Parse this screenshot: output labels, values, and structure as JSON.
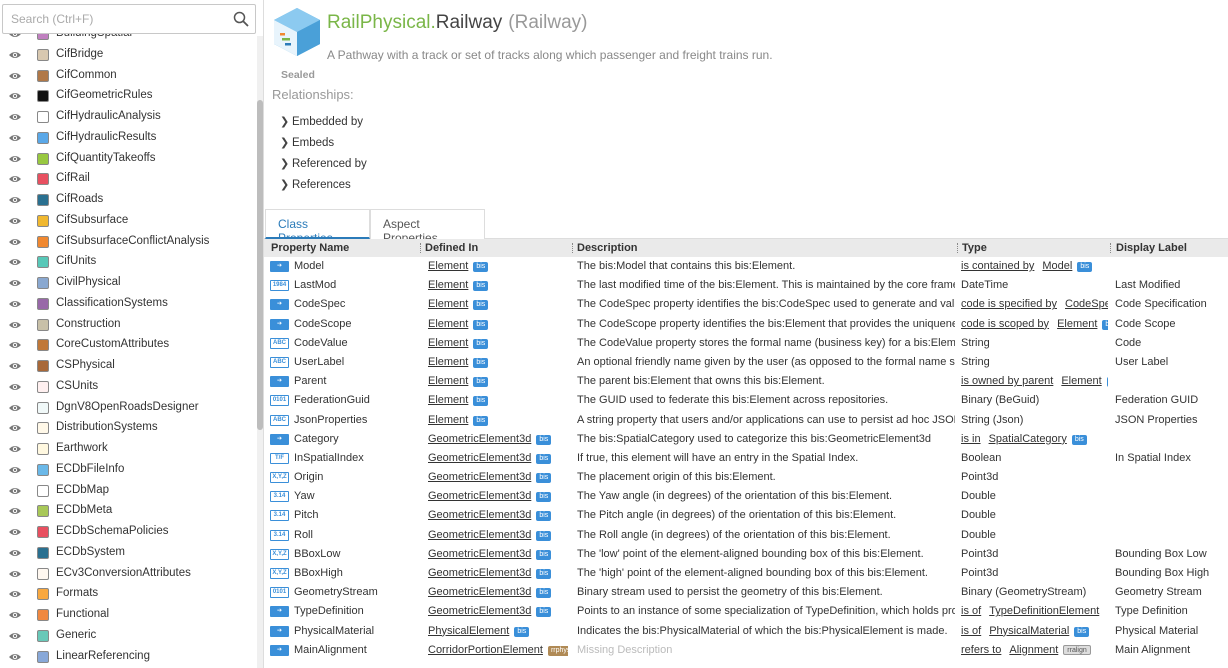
{
  "search": {
    "placeholder": "Search (Ctrl+F)"
  },
  "sidebar": {
    "items": [
      {
        "label": "BuildingSpatial",
        "color": "#c080c0"
      },
      {
        "label": "CifBridge",
        "color": "#d8c8b0"
      },
      {
        "label": "CifCommon",
        "color": "#b07848"
      },
      {
        "label": "CifGeometricRules",
        "color": "#111111"
      },
      {
        "label": "CifHydraulicAnalysis",
        "color": "#ffffff"
      },
      {
        "label": "CifHydraulicResults",
        "color": "#5aa8e8"
      },
      {
        "label": "CifQuantityTakeoffs",
        "color": "#98c840"
      },
      {
        "label": "CifRail",
        "color": "#e85060"
      },
      {
        "label": "CifRoads",
        "color": "#2a7090"
      },
      {
        "label": "CifSubsurface",
        "color": "#f0b830"
      },
      {
        "label": "CifSubsurfaceConflictAnalysis",
        "color": "#f08830"
      },
      {
        "label": "CifUnits",
        "color": "#58c8b8"
      },
      {
        "label": "CivilPhysical",
        "color": "#8aa8d0"
      },
      {
        "label": "ClassificationSystems",
        "color": "#9868a8"
      },
      {
        "label": "Construction",
        "color": "#c8c0a8"
      },
      {
        "label": "CoreCustomAttributes",
        "color": "#c07838"
      },
      {
        "label": "CSPhysical",
        "color": "#a86838"
      },
      {
        "label": "CSUnits",
        "color": "#fff0f0"
      },
      {
        "label": "DgnV8OpenRoadsDesigner",
        "color": "#f0f8f8"
      },
      {
        "label": "DistributionSystems",
        "color": "#fff8e8"
      },
      {
        "label": "Earthwork",
        "color": "#fff8e0"
      },
      {
        "label": "ECDbFileInfo",
        "color": "#6ab8e8"
      },
      {
        "label": "ECDbMap",
        "color": "#ffffff"
      },
      {
        "label": "ECDbMeta",
        "color": "#a8c858"
      },
      {
        "label": "ECDbSchemaPolicies",
        "color": "#e85060"
      },
      {
        "label": "ECDbSystem",
        "color": "#2a7090"
      },
      {
        "label": "ECv3ConversionAttributes",
        "color": "#fff8f0"
      },
      {
        "label": "Formats",
        "color": "#f8a840"
      },
      {
        "label": "Functional",
        "color": "#f08840"
      },
      {
        "label": "Generic",
        "color": "#68c8b8"
      },
      {
        "label": "LinearReferencing",
        "color": "#88a8d8"
      }
    ]
  },
  "header": {
    "schema_name": "RailPhysical",
    "separator": ".",
    "class_name": "Railway",
    "display_label": "(Railway)",
    "description": "A Pathway with a track or set of tracks along which passenger and freight trains run.",
    "modifier": "Sealed"
  },
  "relationships": {
    "title": "Relationships:",
    "items": [
      "Embedded by",
      "Embeds",
      "Referenced by",
      "References"
    ]
  },
  "tabs": {
    "class_properties": "Class Properties",
    "aspect_properties": "Aspect Properties"
  },
  "table": {
    "columns": [
      "Property Name",
      "Defined In",
      "Description",
      "Type",
      "Display Label"
    ],
    "rows": [
      {
        "icon": "nav",
        "name": "Model",
        "defined_in": "Element",
        "defined_badge": "bis",
        "description": "The bis:Model that contains this bis:Element.",
        "type_prefix": "is contained by",
        "type_link": "Model",
        "type_badge": "bis",
        "label": ""
      },
      {
        "icon": "1984",
        "name": "LastMod",
        "defined_in": "Element",
        "defined_badge": "bis",
        "description": "The last modified time of the bis:Element. This is maintained by the core framewo",
        "type": "DateTime",
        "label": "Last Modified"
      },
      {
        "icon": "nav",
        "name": "CodeSpec",
        "defined_in": "Element",
        "defined_badge": "bis",
        "description": "The CodeSpec property identifies the bis:CodeSpec used to generate and validate",
        "type_prefix": "code is specified by",
        "type_link": "CodeSpec",
        "label": "Code Specification"
      },
      {
        "icon": "nav",
        "name": "CodeScope",
        "defined_in": "Element",
        "defined_badge": "bis",
        "description": "The CodeScope property identifies the bis:Element that provides the uniqueness s",
        "type_prefix": "code is scoped by",
        "type_link": "Element",
        "type_badge": "bis",
        "label": "Code Scope"
      },
      {
        "icon": "ABC",
        "name": "CodeValue",
        "defined_in": "Element",
        "defined_badge": "bis",
        "description": "The CodeValue property stores the formal name (business key) for a bis:Element.",
        "type": "String",
        "label": "Code"
      },
      {
        "icon": "ABC",
        "name": "UserLabel",
        "defined_in": "Element",
        "defined_badge": "bis",
        "description": "An optional friendly name given by the user (as opposed to the formal name store",
        "type": "String",
        "label": "User Label"
      },
      {
        "icon": "nav",
        "name": "Parent",
        "defined_in": "Element",
        "defined_badge": "bis",
        "description": "The parent bis:Element that owns this bis:Element.",
        "type_prefix": "is owned by parent",
        "type_link": "Element",
        "type_badge": "bis",
        "label": ""
      },
      {
        "icon": "0101",
        "name": "FederationGuid",
        "defined_in": "Element",
        "defined_badge": "bis",
        "description": "The GUID used to federate this bis:Element across repositories.",
        "type": "Binary (BeGuid)",
        "label": "Federation GUID"
      },
      {
        "icon": "ABC",
        "name": "JsonProperties",
        "defined_in": "Element",
        "defined_badge": "bis",
        "description": "A string property that users and/or applications can use to persist ad hoc JSON va",
        "type": "String (Json)",
        "label": "JSON Properties"
      },
      {
        "icon": "nav",
        "name": "Category",
        "defined_in": "GeometricElement3d",
        "defined_badge": "bis",
        "description": "The bis:SpatialCategory used to categorize this bis:GeometricElement3d",
        "type_prefix": "is in",
        "type_link": "SpatialCategory",
        "type_badge": "bis",
        "label": ""
      },
      {
        "icon": "T/F",
        "name": "InSpatialIndex",
        "defined_in": "GeometricElement3d",
        "defined_badge": "bis",
        "description": "If true, this element will have an entry in the Spatial Index.",
        "type": "Boolean",
        "label": "In Spatial Index"
      },
      {
        "icon": "X,Y,Z",
        "name": "Origin",
        "defined_in": "GeometricElement3d",
        "defined_badge": "bis",
        "description": "The placement origin of this bis:Element.",
        "type": "Point3d",
        "label": ""
      },
      {
        "icon": "3.14",
        "name": "Yaw",
        "defined_in": "GeometricElement3d",
        "defined_badge": "bis",
        "description": "The Yaw angle (in degrees) of the orientation of this bis:Element.",
        "type": "Double",
        "label": ""
      },
      {
        "icon": "3.14",
        "name": "Pitch",
        "defined_in": "GeometricElement3d",
        "defined_badge": "bis",
        "description": "The Pitch angle (in degrees) of the orientation of this bis:Element.",
        "type": "Double",
        "label": ""
      },
      {
        "icon": "3.14",
        "name": "Roll",
        "defined_in": "GeometricElement3d",
        "defined_badge": "bis",
        "description": "The Roll angle (in degrees) of the orientation of this bis:Element.",
        "type": "Double",
        "label": ""
      },
      {
        "icon": "X,Y,Z",
        "name": "BBoxLow",
        "defined_in": "GeometricElement3d",
        "defined_badge": "bis",
        "description": "The 'low' point of the element-aligned bounding box of this bis:Element.",
        "type": "Point3d",
        "label": "Bounding Box Low"
      },
      {
        "icon": "X,Y,Z",
        "name": "BBoxHigh",
        "defined_in": "GeometricElement3d",
        "defined_badge": "bis",
        "description": "The 'high' point of the element-aligned bounding box of this bis:Element.",
        "type": "Point3d",
        "label": "Bounding Box High"
      },
      {
        "icon": "0101",
        "name": "GeometryStream",
        "defined_in": "GeometricElement3d",
        "defined_badge": "bis",
        "description": "Binary stream used to persist the geometry of this bis:Element.",
        "type": "Binary (GeometryStream)",
        "label": "Geometry Stream"
      },
      {
        "icon": "nav",
        "name": "TypeDefinition",
        "defined_in": "GeometricElement3d",
        "defined_badge": "bis",
        "description": "Points to an instance of some specialization of TypeDefinition, which holds proper",
        "type_prefix": "is of",
        "type_link": "TypeDefinitionElement",
        "label": "Type Definition"
      },
      {
        "icon": "nav",
        "name": "PhysicalMaterial",
        "defined_in": "PhysicalElement",
        "defined_badge": "bis",
        "description": "Indicates the bis:PhysicalMaterial of which the bis:PhysicalElement is made.",
        "type_prefix": "is of",
        "type_link": "PhysicalMaterial",
        "type_badge": "bis",
        "label": "Physical Material"
      },
      {
        "icon": "nav",
        "name": "MainAlignment",
        "defined_in": "CorridorPortionElement",
        "defined_badge": "rrphys",
        "description": "Missing Description",
        "type_prefix": "refers to",
        "type_link": "Alignment",
        "type_badge": "rralign",
        "label": "Main Alignment",
        "muted_description": true
      }
    ]
  },
  "colors": {
    "accent": "#2b7bb9",
    "schema_green": "#7ab648",
    "badge_blue": "#3a8fd9"
  }
}
